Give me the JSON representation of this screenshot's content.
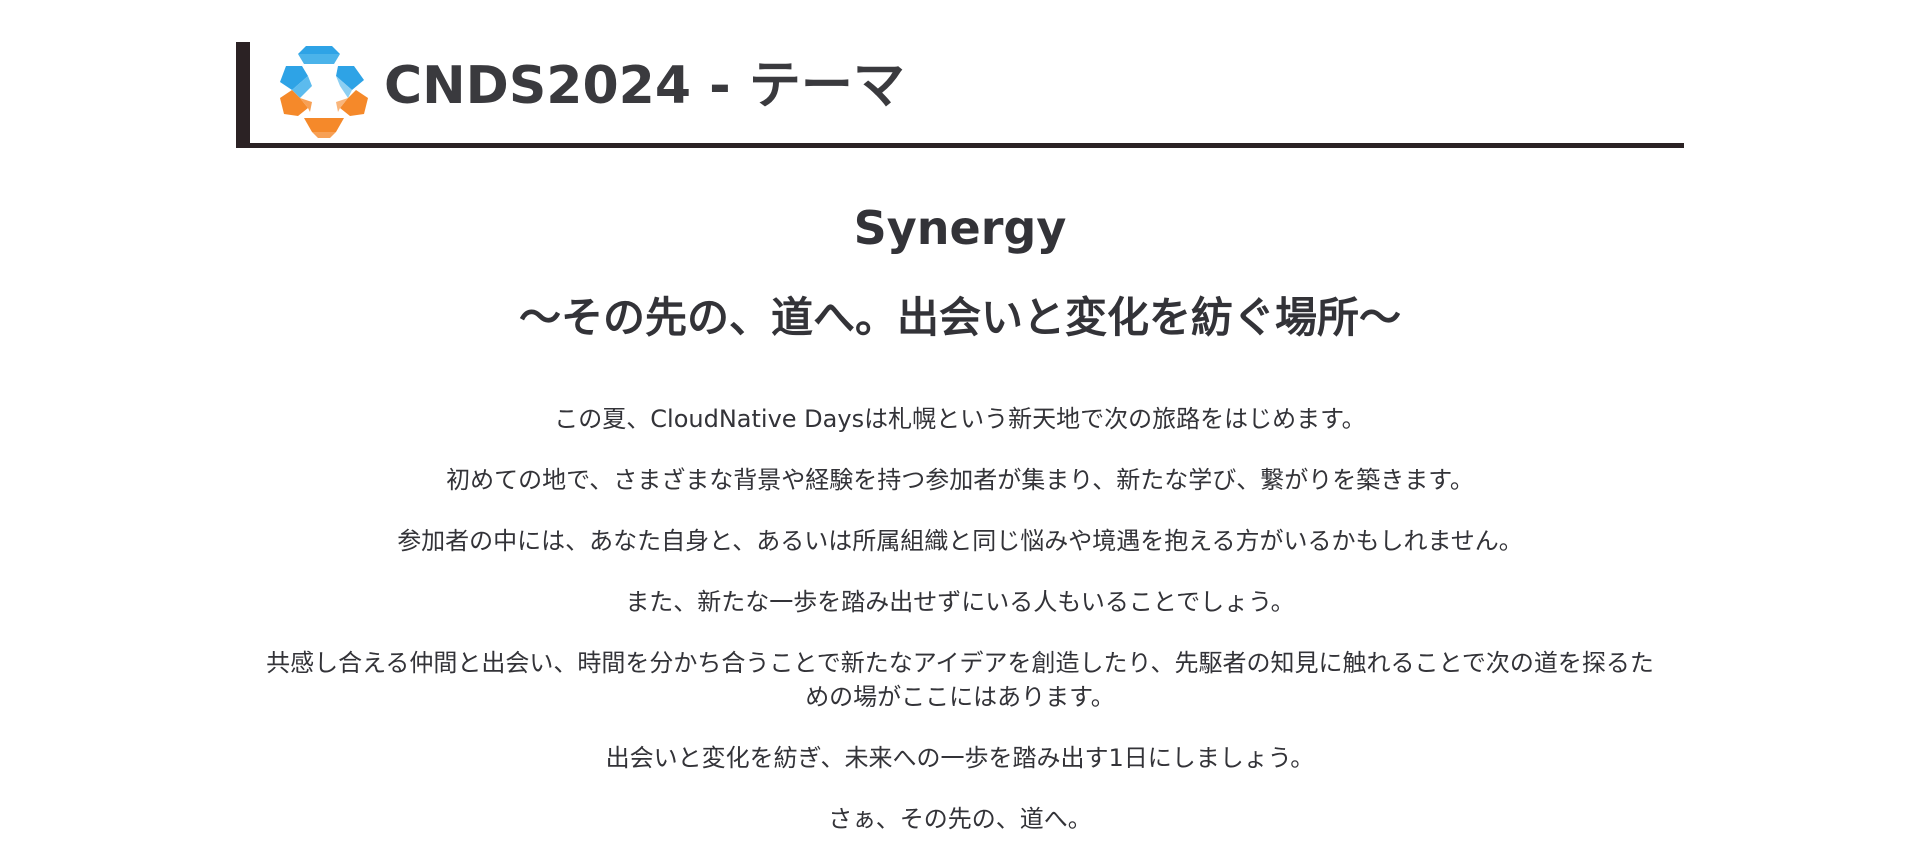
{
  "header": {
    "title": "CNDS2024 - テーマ",
    "logo_colors": {
      "blue": "#2ea3e6",
      "orange": "#f5892a"
    },
    "bar_color": "#2b2224"
  },
  "main": {
    "title": "Synergy",
    "subtitle": "〜その先の、道へ。出会いと変化を紡ぐ場所〜",
    "paragraphs": [
      "この夏、CloudNative Daysは札幌という新天地で次の旅路をはじめます。",
      "初めての地で、さまざまな背景や経験を持つ参加者が集まり、新たな学び、繋がりを築きます。",
      "参加者の中には、あなた自身と、あるいは所属組織と同じ悩みや境遇を抱える方がいるかもしれません。",
      "また、新たな一歩を踏み出せずにいる人もいることでしょう。",
      "共感し合える仲間と出会い、時間を分かち合うことで新たなアイデアを創造したり、先駆者の知見に触れることで次の道を探るための場がここにはあります。",
      "出会いと変化を紡ぎ、未来への一歩を踏み出す1日にしましょう。",
      "さぁ、その先の、道へ。"
    ]
  }
}
